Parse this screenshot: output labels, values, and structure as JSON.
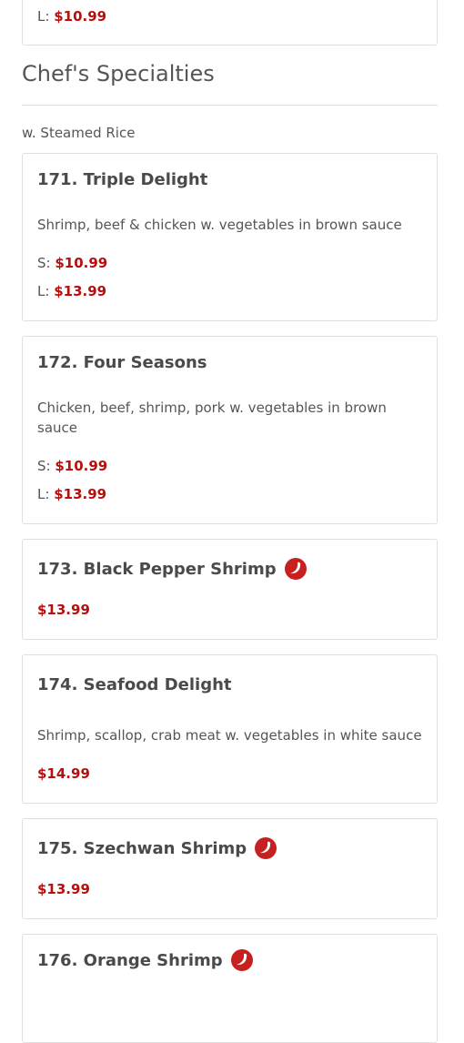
{
  "top_card": {
    "price_label": "L:",
    "price": "$10.99"
  },
  "section": {
    "title": "Chef's Specialties",
    "subtitle": "w. Steamed Rice"
  },
  "items": [
    {
      "name": "171. Triple Delight",
      "description": "Shrimp, beef & chicken w. vegetables in brown sauce",
      "prices": [
        {
          "label": "S:",
          "value": "$10.99"
        },
        {
          "label": "L:",
          "value": "$13.99"
        }
      ],
      "spicy": false
    },
    {
      "name": "172. Four Seasons",
      "description": "Chicken, beef, shrimp, pork w. vegetables in brown sauce",
      "prices": [
        {
          "label": "S:",
          "value": "$10.99"
        },
        {
          "label": "L:",
          "value": "$13.99"
        }
      ],
      "spicy": false
    },
    {
      "name": "173. Black Pepper Shrimp",
      "price": "$13.99",
      "spicy": true,
      "icon": "chili-pepper-icon"
    },
    {
      "name": "174. Seafood Delight",
      "description": "Shrimp, scallop, crab meat w. vegetables in white sauce",
      "price": "$14.99",
      "spicy": false
    },
    {
      "name": "175. Szechwan Shrimp",
      "price": "$13.99",
      "spicy": true,
      "icon": "chili-pepper-icon"
    },
    {
      "name": "176. Orange Shrimp",
      "spicy": true,
      "icon": "chili-pepper-icon"
    }
  ],
  "colors": {
    "price": "#b80e0e",
    "spicy_icon": "#c62020",
    "border": "#e0e0e0",
    "text": "#555555"
  }
}
